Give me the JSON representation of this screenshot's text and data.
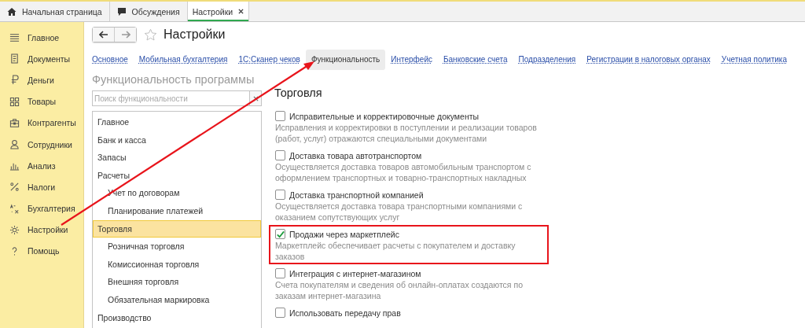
{
  "tabs": [
    {
      "label": "Начальная страница",
      "selected": false,
      "closable": false
    },
    {
      "label": "Обсуждения",
      "selected": false,
      "closable": false
    },
    {
      "label": "Настройки",
      "selected": true,
      "closable": true
    }
  ],
  "sidebar": {
    "items": [
      {
        "label": "Главное"
      },
      {
        "label": "Документы"
      },
      {
        "label": "Деньги"
      },
      {
        "label": "Товары"
      },
      {
        "label": "Контрагенты"
      },
      {
        "label": "Сотрудники"
      },
      {
        "label": "Анализ"
      },
      {
        "label": "Налоги"
      },
      {
        "label": "Бухгалтерия"
      },
      {
        "label": "Настройки"
      },
      {
        "label": "Помощь"
      }
    ]
  },
  "form": {
    "title": "Настройки",
    "favorite": false,
    "tabs": [
      {
        "label": "Основное",
        "selected": false
      },
      {
        "label": "Мобильная бухгалтерия",
        "selected": false
      },
      {
        "label": "1С:Сканер чеков",
        "selected": false
      },
      {
        "label": "Функциональность",
        "selected": true
      },
      {
        "label": "Интерфейс",
        "selected": false
      },
      {
        "label": "Банковские счета",
        "selected": false
      },
      {
        "label": "Подразделения",
        "selected": false
      },
      {
        "label": "Регистрации в налоговых органах",
        "selected": false
      },
      {
        "label": "Учетная политика",
        "selected": false
      }
    ],
    "section_title": "Функциональность программы",
    "search": {
      "placeholder": "Поиск функциональности"
    },
    "tree": [
      {
        "label": "Главное",
        "selected": false
      },
      {
        "label": "Банк и касса",
        "selected": false
      },
      {
        "label": "Запасы",
        "selected": false
      },
      {
        "label": "Расчеты",
        "selected": false,
        "children": [
          {
            "label": "Учет по договорам",
            "selected": false
          },
          {
            "label": "Планирование платежей",
            "selected": false
          }
        ]
      },
      {
        "label": "Торговля",
        "selected": true,
        "children": [
          {
            "label": "Розничная торговля",
            "selected": false
          },
          {
            "label": "Комиссионная торговля",
            "selected": false
          },
          {
            "label": "Внешняя торговля",
            "selected": false
          },
          {
            "label": "Обязательная маркировка",
            "selected": false
          }
        ]
      },
      {
        "label": "Производство",
        "selected": false
      }
    ],
    "group_title": "Торговля",
    "options": [
      {
        "label": "Исправительные и корректировочные документы",
        "checked": false,
        "highlighted": false,
        "description": "Исправления и корректировки в поступлении и реализации товаров (работ, услуг) отражаются специальными документами"
      },
      {
        "label": "Доставка товара автотранспортом",
        "checked": false,
        "highlighted": false,
        "description": "Осуществляется доставка товаров автомобильным транспортом с оформлением транспортных и товарно-транспортных накладных"
      },
      {
        "label": "Доставка транспортной компанией",
        "checked": false,
        "highlighted": false,
        "description": "Осуществляется доставка товара транспортными компаниями с оказанием сопутствующих услуг"
      },
      {
        "label": "Продажи через маркетплейс",
        "checked": true,
        "highlighted": true,
        "description": "Маркетплейс обеспечивает расчеты с покупателем и доставку заказов"
      },
      {
        "label": "Интеграция с интернет-магазином",
        "checked": false,
        "highlighted": false,
        "description": "Счета покупателям и сведения об онлайн-оплатах создаются по заказам интернет-магазина"
      },
      {
        "label": "Использовать передачу прав",
        "checked": false,
        "highlighted": false
      }
    ]
  }
}
